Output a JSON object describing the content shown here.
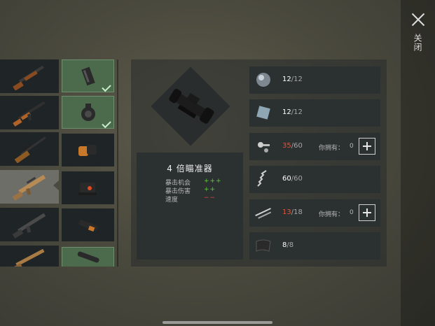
{
  "header": {
    "close_label": "关闭"
  },
  "weapons": [
    {
      "icon": "shotgun-icon"
    },
    {
      "icon": "ak-rifle-icon"
    },
    {
      "icon": "sniper-rifle-icon"
    },
    {
      "icon": "scar-rifle-icon",
      "selected": true
    },
    {
      "icon": "m4-rifle-icon"
    },
    {
      "icon": "dmr-rifle-icon"
    }
  ],
  "attachments": [
    {
      "icon": "magazine-icon",
      "owned": true
    },
    {
      "icon": "drum-magazine-icon",
      "owned": true
    },
    {
      "icon": "quick-magazine-icon",
      "owned": false
    },
    {
      "icon": "red-dot-sight-icon",
      "owned": false
    },
    {
      "icon": "scope-icon",
      "owned": false
    },
    {
      "icon": "long-scope-icon",
      "owned": true
    }
  ],
  "item": {
    "name": "4 倍瞄准器",
    "stats": [
      {
        "label": "暴击机会",
        "value": "+++",
        "tone": "positive"
      },
      {
        "label": "暴击伤害",
        "value": "++",
        "tone": "positive"
      },
      {
        "label": "速度",
        "value": "−−",
        "tone": "negative"
      }
    ]
  },
  "materials": [
    {
      "icon": "lens-icon",
      "have": "12",
      "need": "12",
      "short": false
    },
    {
      "icon": "glass-plate-icon",
      "have": "12",
      "need": "12",
      "short": false
    },
    {
      "icon": "screws-icon",
      "have": "35",
      "need": "60",
      "short": true,
      "own_label": "你拥有：",
      "own_value": "0"
    },
    {
      "icon": "spring-icon",
      "have": "60",
      "need": "60",
      "short": false
    },
    {
      "icon": "metal-rods-icon",
      "have": "13",
      "need": "18",
      "short": true,
      "own_label": "你拥有：",
      "own_value": "0"
    },
    {
      "icon": "metal-sheet-icon",
      "have": "8",
      "need": "8",
      "short": false
    }
  ],
  "colors": {
    "positive": "#62cc3a",
    "negative": "#e04040",
    "owned_slot": "#4c6a4c",
    "shortage": "#e0533a"
  }
}
